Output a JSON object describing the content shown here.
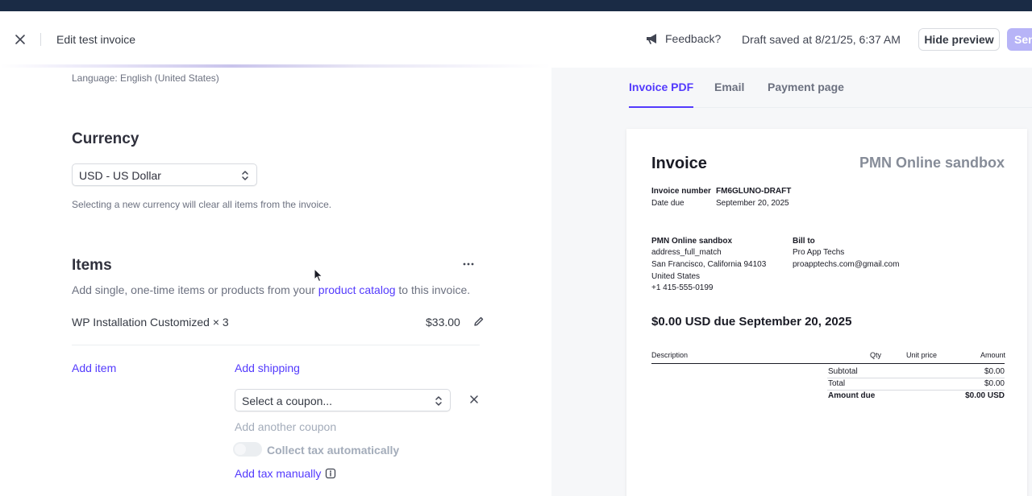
{
  "header": {
    "title": "Edit test invoice",
    "feedback_label": "Feedback?",
    "draft_status": "Draft saved at 8/21/25, 6:37 AM",
    "hide_preview_label": "Hide preview",
    "send_label": "Send"
  },
  "form": {
    "language": "Language: English (United States)",
    "currency": {
      "heading": "Currency",
      "selected": "USD - US Dollar",
      "help": "Selecting a new currency will clear all items from the invoice."
    },
    "items": {
      "heading": "Items",
      "desc_prefix": "Add single, one-time items or products from your",
      "desc_link": "product catalog",
      "desc_suffix": "to this invoice.",
      "list": [
        {
          "name": "WP Installation Customized × 3",
          "price": "$33.00"
        }
      ],
      "add_item": "Add item",
      "add_shipping": "Add shipping",
      "coupon_placeholder": "Select a coupon...",
      "add_another_coupon": "Add another coupon",
      "collect_tax_auto": "Collect tax automatically",
      "add_tax_manually": "Add tax manually"
    }
  },
  "preview": {
    "tabs": [
      "Invoice PDF",
      "Email",
      "Payment page"
    ],
    "active_tab": 0,
    "invoice": {
      "title": "Invoice",
      "company": "PMN Online sandbox",
      "number_label": "Invoice number",
      "number": "FM6GLUNO-DRAFT",
      "due_label": "Date due",
      "due_date": "September 20, 2025",
      "from": [
        "PMN Online sandbox",
        "address_full_match",
        "San Francisco, California 94103",
        "United States",
        "+1 415-555-0199"
      ],
      "bill_to_label": "Bill to",
      "bill_to": [
        "Pro App Techs",
        "proapptechs.com@gmail.com"
      ],
      "due_headline": "$0.00 USD due September 20, 2025",
      "columns": [
        "Description",
        "Qty",
        "Unit price",
        "Amount"
      ],
      "summary": [
        {
          "label": "Subtotal",
          "value": "$0.00"
        },
        {
          "label": "Total",
          "value": "$0.00"
        },
        {
          "label": "Amount due",
          "value": "$0.00 USD"
        }
      ]
    }
  },
  "colors": {
    "accent": "#533afd",
    "topbar": "#1a2b45",
    "send_disabled": "#b7b4f7"
  }
}
